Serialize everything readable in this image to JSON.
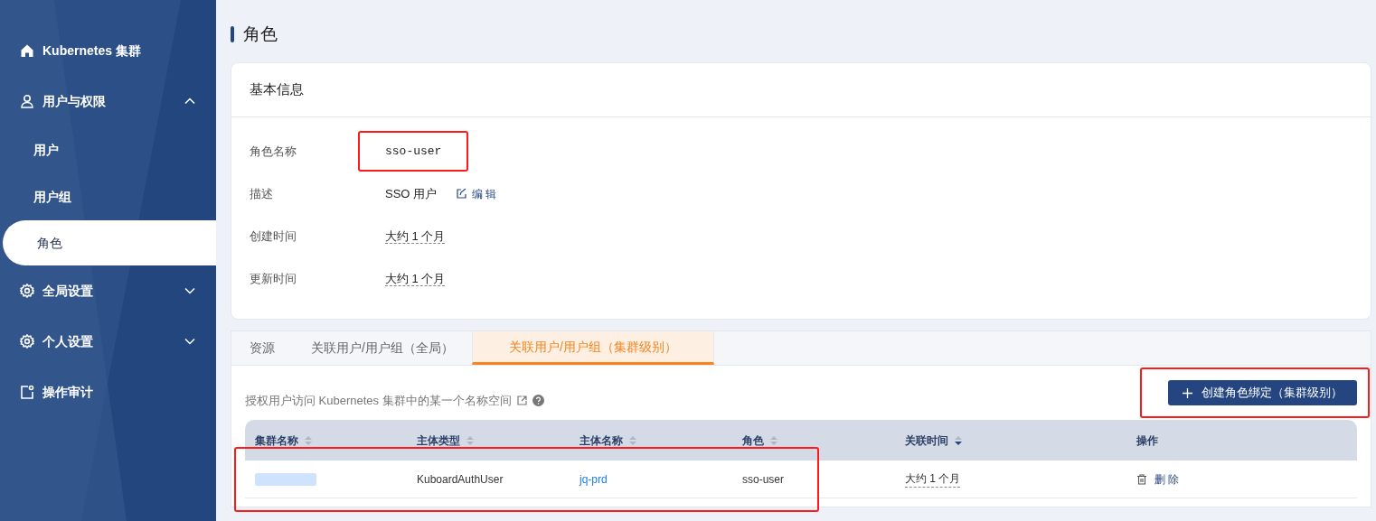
{
  "sidebar": {
    "items": [
      {
        "kind": "link",
        "label": "Kubernetes 集群",
        "selected": false
      },
      {
        "kind": "group",
        "label": "用户与权限",
        "expanded": true,
        "children": [
          {
            "label": "用户",
            "selected": false
          },
          {
            "label": "用户组",
            "selected": false
          },
          {
            "label": "角色",
            "selected": true
          }
        ]
      },
      {
        "kind": "group",
        "label": "全局设置",
        "expanded": false
      },
      {
        "kind": "group",
        "label": "个人设置",
        "expanded": false
      },
      {
        "kind": "link",
        "label": "操作审计",
        "selected": false
      }
    ]
  },
  "page_title": "角色",
  "basic_info": {
    "title": "基本信息",
    "rows": [
      {
        "kind": "code",
        "label": "角色名称",
        "value": "sso-user",
        "highlighted": true
      },
      {
        "kind": "editable",
        "label": "描述",
        "value": "SSO 用户",
        "action": "编 辑",
        "highlighted": false
      },
      {
        "kind": "time",
        "label": "创建时间",
        "value": "大约 1 个月",
        "highlighted": false
      },
      {
        "kind": "time",
        "label": "更新时间",
        "value": "大约 1 个月",
        "highlighted": false
      }
    ]
  },
  "tabs": [
    {
      "label": "资源",
      "selected": false
    },
    {
      "label": "关联用户/用户组（全局）",
      "selected": false
    },
    {
      "label": "关联用户/用户组（集群级别）",
      "selected": true
    }
  ],
  "description": "授权用户访问 Kubernetes 集群中的某一个名称空间",
  "create_button": {
    "label": "创建角色绑定（集群级别）",
    "highlighted": true
  },
  "table": {
    "columns": [
      {
        "label": "集群名称",
        "sort_descending": false
      },
      {
        "label": "主体类型",
        "sort_descending": false
      },
      {
        "label": "主体名称",
        "sort_descending": false
      },
      {
        "label": "角色",
        "sort_descending": false
      },
      {
        "label": "关联时间",
        "sort_descending": true
      },
      {
        "label": "操作"
      }
    ],
    "rows": [
      {
        "highlighted": true,
        "cells": [
          {
            "kind": "redacted"
          },
          {
            "kind": "text",
            "text": "KuboardAuthUser"
          },
          {
            "kind": "link",
            "text": "jq-prd"
          },
          {
            "kind": "text",
            "text": "sso-user"
          },
          {
            "kind": "time",
            "text": "大约 1 个月"
          },
          {
            "kind": "action",
            "text": "删 除"
          }
        ]
      }
    ]
  }
}
